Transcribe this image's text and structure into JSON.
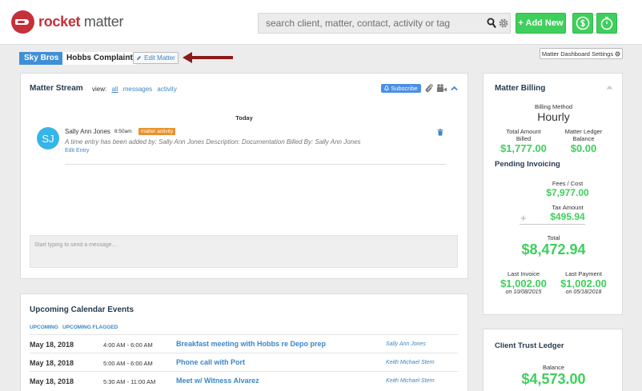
{
  "header": {
    "logo_brand": "rocket",
    "logo_suffix": " matter",
    "search_placeholder": "search client, matter, contact, activity or tag",
    "add_new_label": "+ Add New",
    "colors": {
      "brand": "#c6303a",
      "accent_green": "#3fcf5c",
      "link": "#3b86c8"
    }
  },
  "breadcrumb": {
    "client": "Sky Bros",
    "matter": "Hobbs Complaint",
    "edit_label": "Edit Matter",
    "settings_label": "Matter Dashboard Settings"
  },
  "stream": {
    "title": "Matter Stream",
    "view_label": "view:",
    "filters": [
      "all",
      "messages",
      "activity"
    ],
    "subscribe_label": "Subscribe",
    "day_label": "Today",
    "entry": {
      "initials": "SJ",
      "name": "Sally Ann Jones",
      "time": "8:50am",
      "badge": "matter activity",
      "text": "A time entry has been added by: Sally Ann Jones Description: Documentation Billed By: Sally Ann Jones",
      "edit_label": "Edit Entry"
    },
    "message_placeholder": "Start typing to send a message..."
  },
  "events": {
    "title": "Upcoming Calendar Events",
    "tabs": [
      "UPCOMING",
      "UPCOMING FLAGGED"
    ],
    "rows": [
      {
        "date": "May 18, 2018",
        "time": "4:00 AM - 6:00 AM",
        "title": "Breakfast meeting with Hobbs re Depo prep",
        "person": "Sally Ann Jones"
      },
      {
        "date": "May 18, 2018",
        "time": "5:00 AM - 6:00 AM",
        "title": "Phone call with Port",
        "person": "Keith Michael Stern"
      },
      {
        "date": "May 18, 2018",
        "time": "5:30 AM - 11:00 AM",
        "title": "Meet w/ Witness Alvarez",
        "person": "Keith Michael Stern"
      }
    ]
  },
  "billing": {
    "title": "Matter Billing",
    "method_label": "Billing Method",
    "method_value": "Hourly",
    "total_billed_label_1": "Total Amount",
    "total_billed_label_2": "Billed",
    "total_billed_value": "$1,777.00",
    "ledger_label_1": "Matter Ledger",
    "ledger_label_2": "Balance",
    "ledger_value": "$0.00",
    "pending_label": "Pending Invoicing",
    "fees_label": "Fees / Cost",
    "fees_value": "$7,977.00",
    "tax_label": "Tax Amount",
    "tax_plus": "+",
    "tax_value": "$495.94",
    "total_label": "Total",
    "total_value": "$8,472.94",
    "last_invoice_label": "Last Invoice",
    "last_invoice_value": "$1,002.00",
    "last_invoice_date": "on 10/08/2015",
    "last_payment_label": "Last Payment",
    "last_payment_value": "$1,002.00",
    "last_payment_date": "on 05/18/2018"
  },
  "trust": {
    "title": "Client Trust Ledger",
    "balance_label": "Balance",
    "balance_value": "$4,573.00"
  }
}
